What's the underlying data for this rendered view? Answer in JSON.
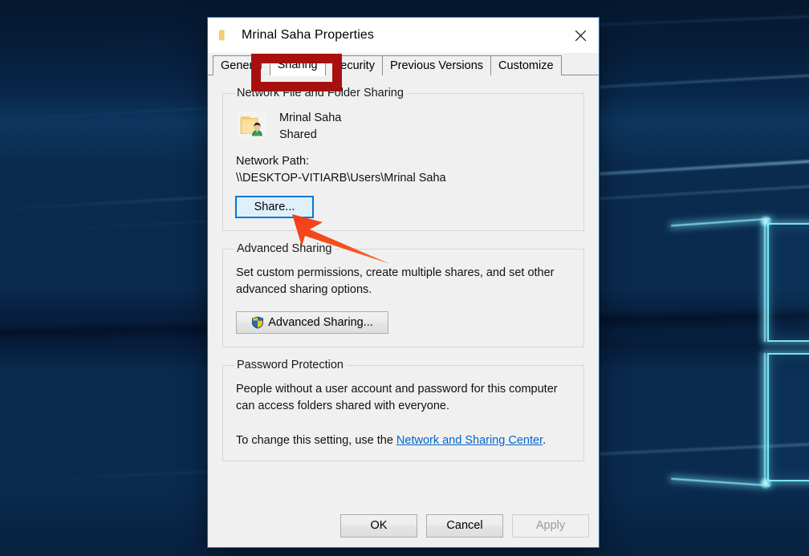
{
  "window": {
    "title": "Mrinal Saha Properties",
    "title_icon": "folder-icon",
    "close_icon": "close-icon",
    "accent_color": "#0078d7"
  },
  "tabs": [
    {
      "label": "General",
      "active": false
    },
    {
      "label": "Sharing",
      "active": true
    },
    {
      "label": "Security",
      "active": false
    },
    {
      "label": "Previous Versions",
      "active": false
    },
    {
      "label": "Customize",
      "active": false
    }
  ],
  "network_sharing": {
    "legend": "Network File and Folder Sharing",
    "icon": "shared-folder-user-icon",
    "folder_name": "Mrinal Saha",
    "status": "Shared",
    "path_label": "Network Path:",
    "path_value": "\\\\DESKTOP-VITIARB\\Users\\Mrinal Saha",
    "share_button": "Share...",
    "share_button_focused": true
  },
  "advanced_sharing": {
    "legend": "Advanced Sharing",
    "description": "Set custom permissions, create multiple shares, and set other advanced sharing options.",
    "button_label": "Advanced Sharing...",
    "button_icon": "uac-shield-icon"
  },
  "password_protection": {
    "legend": "Password Protection",
    "description": "People without a user account and password for this computer can access folders shared with everyone.",
    "change_prefix": "To change this setting, use the ",
    "link_text": "Network and Sharing Center",
    "change_suffix": "."
  },
  "footer": {
    "ok": "OK",
    "cancel": "Cancel",
    "apply": "Apply",
    "apply_disabled": true
  },
  "annotations": {
    "highlight_box_target": "Sharing",
    "highlight_color": "#a81010",
    "arrow_color": "#f4411e",
    "arrow_target": "Share..."
  }
}
